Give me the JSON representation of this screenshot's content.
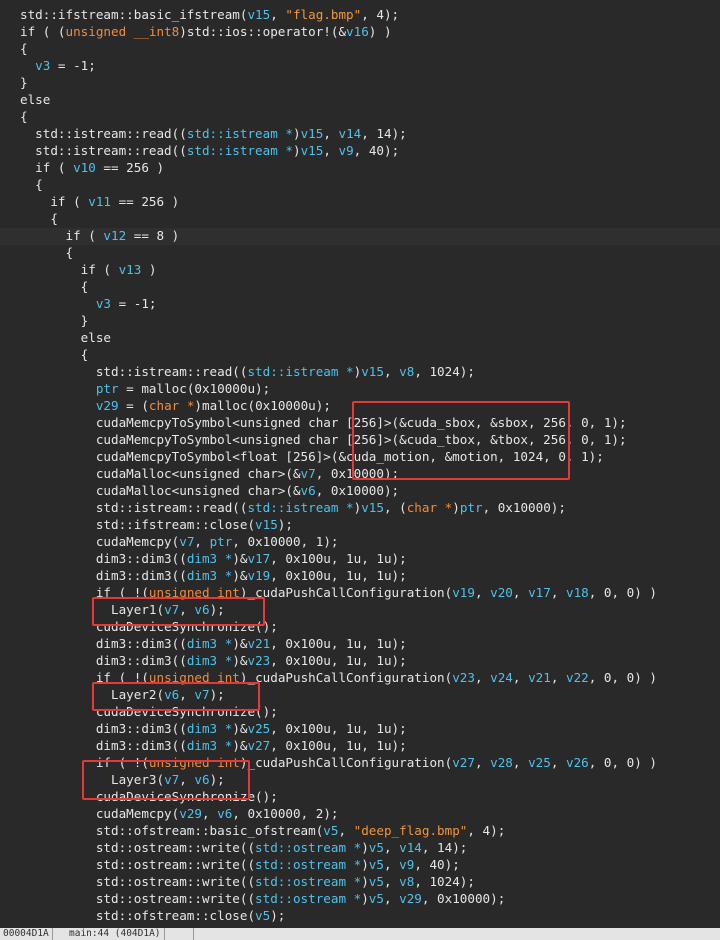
{
  "colors": {
    "background": "#292929",
    "plain": "#e6e6e6",
    "variable": "#4fc1e9",
    "keyword": "#f08c3c",
    "string": "#f0963c",
    "annotation": "#e53935"
  },
  "code": {
    "lines": [
      [
        [
          "std::ifstream::basic_ifstream(",
          "p"
        ],
        [
          "v15",
          "v"
        ],
        [
          ", ",
          "p"
        ],
        [
          "\"flag.bmp\"",
          "s"
        ],
        [
          ", 4);",
          "p"
        ]
      ],
      [
        [
          "if ( (",
          "p"
        ],
        [
          "unsigned __int8",
          "k"
        ],
        [
          ")std::ios::operator!(&",
          "p"
        ],
        [
          "v16",
          "v"
        ],
        [
          ") )",
          "p"
        ]
      ],
      [
        [
          "{",
          "p"
        ]
      ],
      [
        [
          "  ",
          "p"
        ],
        [
          "v3",
          "v"
        ],
        [
          " = -1;",
          "p"
        ]
      ],
      [
        [
          "}",
          "p"
        ]
      ],
      [
        [
          "else",
          "p"
        ]
      ],
      [
        [
          "{",
          "p"
        ]
      ],
      [
        [
          "  std::istream::read((",
          "p"
        ],
        [
          "std::istream *",
          "v"
        ],
        [
          ")",
          "p"
        ],
        [
          "v15",
          "v"
        ],
        [
          ", ",
          "p"
        ],
        [
          "v14",
          "v"
        ],
        [
          ", 14);",
          "p"
        ]
      ],
      [
        [
          "  std::istream::read((",
          "p"
        ],
        [
          "std::istream *",
          "v"
        ],
        [
          ")",
          "p"
        ],
        [
          "v15",
          "v"
        ],
        [
          ", ",
          "p"
        ],
        [
          "v9",
          "v"
        ],
        [
          ", 40);",
          "p"
        ]
      ],
      [
        [
          "  if ( ",
          "p"
        ],
        [
          "v10",
          "v"
        ],
        [
          " == 256 )",
          "p"
        ]
      ],
      [
        [
          "  {",
          "p"
        ]
      ],
      [
        [
          "    if ( ",
          "p"
        ],
        [
          "v11",
          "v"
        ],
        [
          " == 256 )",
          "p"
        ]
      ],
      [
        [
          "    {",
          "p"
        ]
      ],
      [
        [
          "      if ( ",
          "p"
        ],
        [
          "v12",
          "v"
        ],
        [
          " == 8 )",
          "p"
        ]
      ],
      [
        [
          "      {",
          "p"
        ]
      ],
      [
        [
          "        if ( ",
          "p"
        ],
        [
          "v13",
          "v"
        ],
        [
          " )",
          "p"
        ]
      ],
      [
        [
          "        {",
          "p"
        ]
      ],
      [
        [
          "          ",
          "p"
        ],
        [
          "v3",
          "v"
        ],
        [
          " = -1;",
          "p"
        ]
      ],
      [
        [
          "        }",
          "p"
        ]
      ],
      [
        [
          "        else",
          "p"
        ]
      ],
      [
        [
          "        {",
          "p"
        ]
      ],
      [
        [
          "          std::istream::read((",
          "p"
        ],
        [
          "std::istream *",
          "v"
        ],
        [
          ")",
          "p"
        ],
        [
          "v15",
          "v"
        ],
        [
          ", ",
          "p"
        ],
        [
          "v8",
          "v"
        ],
        [
          ", 1024);",
          "p"
        ]
      ],
      [
        [
          "          ",
          "p"
        ],
        [
          "ptr",
          "v"
        ],
        [
          " = malloc(0x10000u);",
          "p"
        ]
      ],
      [
        [
          "          ",
          "p"
        ],
        [
          "v29",
          "v"
        ],
        [
          " = (",
          "p"
        ],
        [
          "char *",
          "k"
        ],
        [
          ")malloc(0x10000u);",
          "p"
        ]
      ],
      [
        [
          "          cudaMemcpyToSymbol<unsigned char [256]>(&cuda_sbox, &sbox, 256, 0, 1);",
          "p"
        ]
      ],
      [
        [
          "          cudaMemcpyToSymbol<unsigned char [256]>(&cuda_tbox, &tbox, 256, 0, 1);",
          "p"
        ]
      ],
      [
        [
          "          cudaMemcpyToSymbol<float [256]>(&cuda_motion, &motion, 1024, 0, 1);",
          "p"
        ]
      ],
      [
        [
          "          cudaMalloc<unsigned char>(&",
          "p"
        ],
        [
          "v7",
          "v"
        ],
        [
          ", 0x10000);",
          "p"
        ]
      ],
      [
        [
          "          cudaMalloc<unsigned char>(&",
          "p"
        ],
        [
          "v6",
          "v"
        ],
        [
          ", 0x10000);",
          "p"
        ]
      ],
      [
        [
          "          std::istream::read((",
          "p"
        ],
        [
          "std::istream *",
          "v"
        ],
        [
          ")",
          "p"
        ],
        [
          "v15",
          "v"
        ],
        [
          ", (",
          "p"
        ],
        [
          "char *",
          "k"
        ],
        [
          ")",
          "p"
        ],
        [
          "ptr",
          "v"
        ],
        [
          ", 0x10000);",
          "p"
        ]
      ],
      [
        [
          "          std::ifstream::close(",
          "p"
        ],
        [
          "v15",
          "v"
        ],
        [
          ");",
          "p"
        ]
      ],
      [
        [
          "          cudaMemcpy(",
          "p"
        ],
        [
          "v7",
          "v"
        ],
        [
          ", ",
          "p"
        ],
        [
          "ptr",
          "v"
        ],
        [
          ", 0x10000, 1);",
          "p"
        ]
      ],
      [
        [
          "          dim3::dim3((",
          "p"
        ],
        [
          "dim3 *",
          "v"
        ],
        [
          ")&",
          "p"
        ],
        [
          "v17",
          "v"
        ],
        [
          ", 0x100u, 1u, 1u);",
          "p"
        ]
      ],
      [
        [
          "          dim3::dim3((",
          "p"
        ],
        [
          "dim3 *",
          "v"
        ],
        [
          ")&",
          "p"
        ],
        [
          "v19",
          "v"
        ],
        [
          ", 0x100u, 1u, 1u);",
          "p"
        ]
      ],
      [
        [
          "          if ( !(",
          "p"
        ],
        [
          "unsigned int",
          "k"
        ],
        [
          ")_cudaPushCallConfiguration(",
          "p"
        ],
        [
          "v19",
          "v"
        ],
        [
          ", ",
          "p"
        ],
        [
          "v20",
          "v"
        ],
        [
          ", ",
          "p"
        ],
        [
          "v17",
          "v"
        ],
        [
          ", ",
          "p"
        ],
        [
          "v18",
          "v"
        ],
        [
          ", 0, 0) )",
          "p"
        ]
      ],
      [
        [
          "            Layer1(",
          "p"
        ],
        [
          "v7",
          "v"
        ],
        [
          ", ",
          "p"
        ],
        [
          "v6",
          "v"
        ],
        [
          ");",
          "p"
        ]
      ],
      [
        [
          "          cudaDeviceSynchronize();",
          "p"
        ]
      ],
      [
        [
          "          dim3::dim3((",
          "p"
        ],
        [
          "dim3 *",
          "v"
        ],
        [
          ")&",
          "p"
        ],
        [
          "v21",
          "v"
        ],
        [
          ", 0x100u, 1u, 1u);",
          "p"
        ]
      ],
      [
        [
          "          dim3::dim3((",
          "p"
        ],
        [
          "dim3 *",
          "v"
        ],
        [
          ")&",
          "p"
        ],
        [
          "v23",
          "v"
        ],
        [
          ", 0x100u, 1u, 1u);",
          "p"
        ]
      ],
      [
        [
          "          if ( !(",
          "p"
        ],
        [
          "unsigned int",
          "k"
        ],
        [
          ")_cudaPushCallConfiguration(",
          "p"
        ],
        [
          "v23",
          "v"
        ],
        [
          ", ",
          "p"
        ],
        [
          "v24",
          "v"
        ],
        [
          ", ",
          "p"
        ],
        [
          "v21",
          "v"
        ],
        [
          ", ",
          "p"
        ],
        [
          "v22",
          "v"
        ],
        [
          ", 0, 0) )",
          "p"
        ]
      ],
      [
        [
          "            Layer2(",
          "p"
        ],
        [
          "v6",
          "v"
        ],
        [
          ", ",
          "p"
        ],
        [
          "v7",
          "v"
        ],
        [
          ");",
          "p"
        ]
      ],
      [
        [
          "          cudaDeviceSynchronize();",
          "p"
        ]
      ],
      [
        [
          "          dim3::dim3((",
          "p"
        ],
        [
          "dim3 *",
          "v"
        ],
        [
          ")&",
          "p"
        ],
        [
          "v25",
          "v"
        ],
        [
          ", 0x100u, 1u, 1u);",
          "p"
        ]
      ],
      [
        [
          "          dim3::dim3((",
          "p"
        ],
        [
          "dim3 *",
          "v"
        ],
        [
          ")&",
          "p"
        ],
        [
          "v27",
          "v"
        ],
        [
          ", 0x100u, 1u, 1u);",
          "p"
        ]
      ],
      [
        [
          "          if ( !(",
          "p"
        ],
        [
          "unsigned int",
          "k"
        ],
        [
          ")_cudaPushCallConfiguration(",
          "p"
        ],
        [
          "v27",
          "v"
        ],
        [
          ", ",
          "p"
        ],
        [
          "v28",
          "v"
        ],
        [
          ", ",
          "p"
        ],
        [
          "v25",
          "v"
        ],
        [
          ", ",
          "p"
        ],
        [
          "v26",
          "v"
        ],
        [
          ", 0, 0) )",
          "p"
        ]
      ],
      [
        [
          "            Layer3(",
          "p"
        ],
        [
          "v7",
          "v"
        ],
        [
          ", ",
          "p"
        ],
        [
          "v6",
          "v"
        ],
        [
          ");",
          "p"
        ]
      ],
      [
        [
          "          cudaDeviceSynchronize();",
          "p"
        ]
      ],
      [
        [
          "          cudaMemcpy(",
          "p"
        ],
        [
          "v29",
          "v"
        ],
        [
          ", ",
          "p"
        ],
        [
          "v6",
          "v"
        ],
        [
          ", 0x10000, 2);",
          "p"
        ]
      ],
      [
        [
          "          std::ofstream::basic_ofstream(",
          "p"
        ],
        [
          "v5",
          "v"
        ],
        [
          ", ",
          "p"
        ],
        [
          "\"deep_flag.bmp\"",
          "s"
        ],
        [
          ", 4);",
          "p"
        ]
      ],
      [
        [
          "          std::ostream::write((",
          "p"
        ],
        [
          "std::ostream *",
          "v"
        ],
        [
          ")",
          "p"
        ],
        [
          "v5",
          "v"
        ],
        [
          ", ",
          "p"
        ],
        [
          "v14",
          "v"
        ],
        [
          ", 14);",
          "p"
        ]
      ],
      [
        [
          "          std::ostream::write((",
          "p"
        ],
        [
          "std::ostream *",
          "v"
        ],
        [
          ")",
          "p"
        ],
        [
          "v5",
          "v"
        ],
        [
          ", ",
          "p"
        ],
        [
          "v9",
          "v"
        ],
        [
          ", 40);",
          "p"
        ]
      ],
      [
        [
          "          std::ostream::write((",
          "p"
        ],
        [
          "std::ostream *",
          "v"
        ],
        [
          ")",
          "p"
        ],
        [
          "v5",
          "v"
        ],
        [
          ", ",
          "p"
        ],
        [
          "v8",
          "v"
        ],
        [
          ", 1024);",
          "p"
        ]
      ],
      [
        [
          "          std::ostream::write((",
          "p"
        ],
        [
          "std::ostream *",
          "v"
        ],
        [
          ")",
          "p"
        ],
        [
          "v5",
          "v"
        ],
        [
          ", ",
          "p"
        ],
        [
          "v29",
          "v"
        ],
        [
          ", 0x10000);",
          "p"
        ]
      ],
      [
        [
          "          std::ofstream::close(",
          "p"
        ],
        [
          "v5",
          "v"
        ],
        [
          ");",
          "p"
        ]
      ]
    ]
  },
  "status_bar": {
    "address": "00004D1A",
    "location": "main:44 (404D1A)"
  }
}
